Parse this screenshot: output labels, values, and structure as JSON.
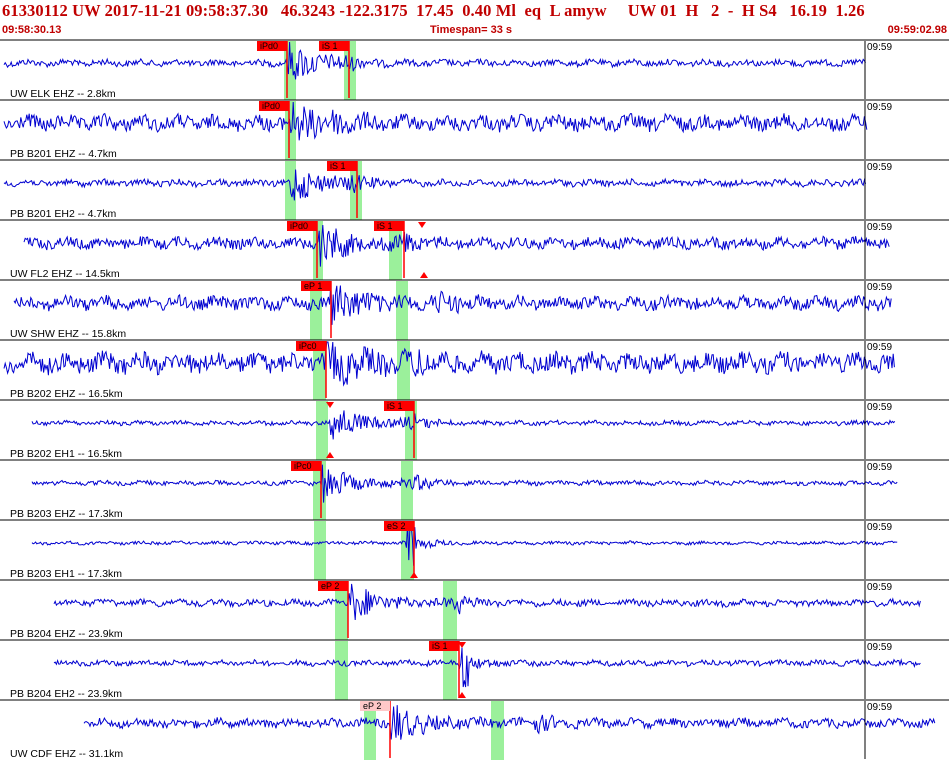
{
  "header": {
    "text": "61330112 UW 2017-11-21 09:58:37.30   46.3243 -122.3175  17.45  0.40 Ml  eq  L amyw     UW 01  H   2  -  H S4   16.19  1.26",
    "start_time": "09:58:30.13",
    "timespan": "Timespan=  33 s",
    "end_time": "09:59:02.98"
  },
  "colors": {
    "trace": "#0000d0",
    "pick": "#ff0000",
    "pick_alt": "#ffc8c8",
    "window": "#90ee90",
    "separator": "#000000",
    "header": "#c00000"
  },
  "chart_data": {
    "type": "seismogram",
    "time_axis": {
      "tick_label": "09:59"
    },
    "traces": [
      {
        "label": "UW ELK EHZ -- 2.8km",
        "time_label": "09:59",
        "picks": [
          {
            "label": "iPd0"
          },
          {
            "label": "iS 1"
          }
        ]
      },
      {
        "label": "PB B201 EHZ -- 4.7km",
        "time_label": "09:59",
        "picks": [
          {
            "label": "iPd0"
          }
        ]
      },
      {
        "label": "PB B201 EH2 -- 4.7km",
        "time_label": "09:59",
        "picks": [
          {
            "label": "iS 1"
          }
        ]
      },
      {
        "label": "UW FL2 EHZ -- 14.5km",
        "time_label": "09:59",
        "picks": [
          {
            "label": "iPd0"
          },
          {
            "label": "iS 1"
          }
        ]
      },
      {
        "label": "UW SHW EHZ -- 15.8km",
        "time_label": "09:59",
        "picks": [
          {
            "label": "eP 1"
          }
        ]
      },
      {
        "label": "PB B202 EHZ -- 16.5km",
        "time_label": "09:59",
        "picks": [
          {
            "label": "iPc0"
          }
        ]
      },
      {
        "label": "PB B202 EH1 -- 16.5km",
        "time_label": "09:59",
        "picks": [
          {
            "label": "iS 1"
          }
        ]
      },
      {
        "label": "PB B203 EHZ -- 17.3km",
        "time_label": "09:59",
        "picks": [
          {
            "label": "iPc0"
          }
        ]
      },
      {
        "label": "PB B203 EH1 -- 17.3km",
        "time_label": "09:59",
        "picks": [
          {
            "label": "eS 2"
          }
        ]
      },
      {
        "label": "PB B204 EHZ -- 23.9km",
        "time_label": "09:59",
        "picks": [
          {
            "label": "eP 2"
          }
        ]
      },
      {
        "label": "PB B204 EH2 -- 23.9km",
        "time_label": "09:59",
        "picks": [
          {
            "label": "iS 1"
          }
        ]
      },
      {
        "label": "UW CDF EHZ -- 31.1km",
        "time_label": "09:59",
        "picks": [
          {
            "label": "eP 2"
          }
        ]
      }
    ]
  }
}
